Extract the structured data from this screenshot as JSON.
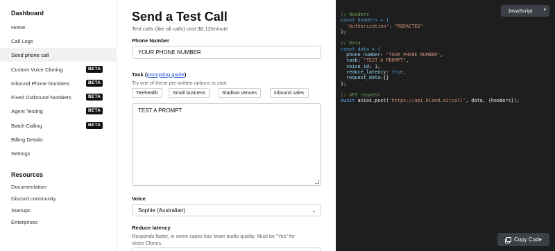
{
  "sidebar": {
    "dashboard_title": "Dashboard",
    "items": [
      {
        "label": "Home"
      },
      {
        "label": "Call Logs"
      },
      {
        "label": "Send phone call"
      },
      {
        "label": "Custom Voice Cloning",
        "badge": "BETA"
      },
      {
        "label": "Inbound Phone Numbers",
        "badge": "BETA"
      },
      {
        "label": "Fixed Outbound Numbers",
        "badge": "BETA"
      },
      {
        "label": "Agent Testing",
        "badge": "BETA"
      },
      {
        "label": "Batch Calling",
        "badge": "BETA"
      },
      {
        "label": "Billing Details"
      },
      {
        "label": "Settings"
      }
    ],
    "resources_title": "Resources",
    "resources": [
      {
        "label": "Documentation"
      },
      {
        "label": "Discord community"
      },
      {
        "label": "Startups"
      },
      {
        "label": "Enterprises"
      }
    ]
  },
  "main": {
    "title": "Send a Test Call",
    "subtitle": "Test calls (like all calls) cost $0.12/minute",
    "phone_label": "Phone Number",
    "phone_value": "YOUR PHONE NUMBER",
    "task_label": "Task (",
    "task_link": "prompting guide",
    "task_label_end": ")",
    "task_helper": "Try one of these pre-written options to start.",
    "chips": [
      "Telehealth",
      "Small business",
      "Stadium venues",
      "Inbound sales"
    ],
    "task_value": "TEST A PROMPT",
    "voice_label": "Voice",
    "voice_value": "Sophie (Australian)",
    "latency_label": "Reduce latency",
    "latency_help_1": "Responds faster, in some cases has lower audio quality. Must be \"Yes\" for",
    "latency_help_2": "Voice Clones."
  },
  "code": {
    "language": "JavaScript",
    "copy_label": "Copy Code",
    "lines": {
      "c1": "// Headers",
      "c2": "const headers = {",
      "c3a": "  'Authorization'",
      "c3b": ": ",
      "c3c": "\"REDACTED\"",
      "c4": "};",
      "c5": "// Data",
      "c6": "const data = {",
      "c7a": "  phone_number",
      "c7b": ": ",
      "c7c": "\"YOUR PHONE NUMBER\"",
      "c8a": "  task",
      "c8b": ": ",
      "c8c": "\"TEST A PROMPT\"",
      "c9a": "  voice_id",
      "c9b": ": ",
      "c9c": "1",
      "c10a": "  reduce_latency",
      "c10b": ": ",
      "c10c": "true",
      "c11a": "  request_data",
      "c11b": ":{}",
      "c12": "};",
      "c13": "// API request",
      "c14a": "await",
      "c14b": " axios.post(",
      "c14c": "'https://api.bland.ai/call'",
      "c14d": ", data, {headers});"
    }
  }
}
